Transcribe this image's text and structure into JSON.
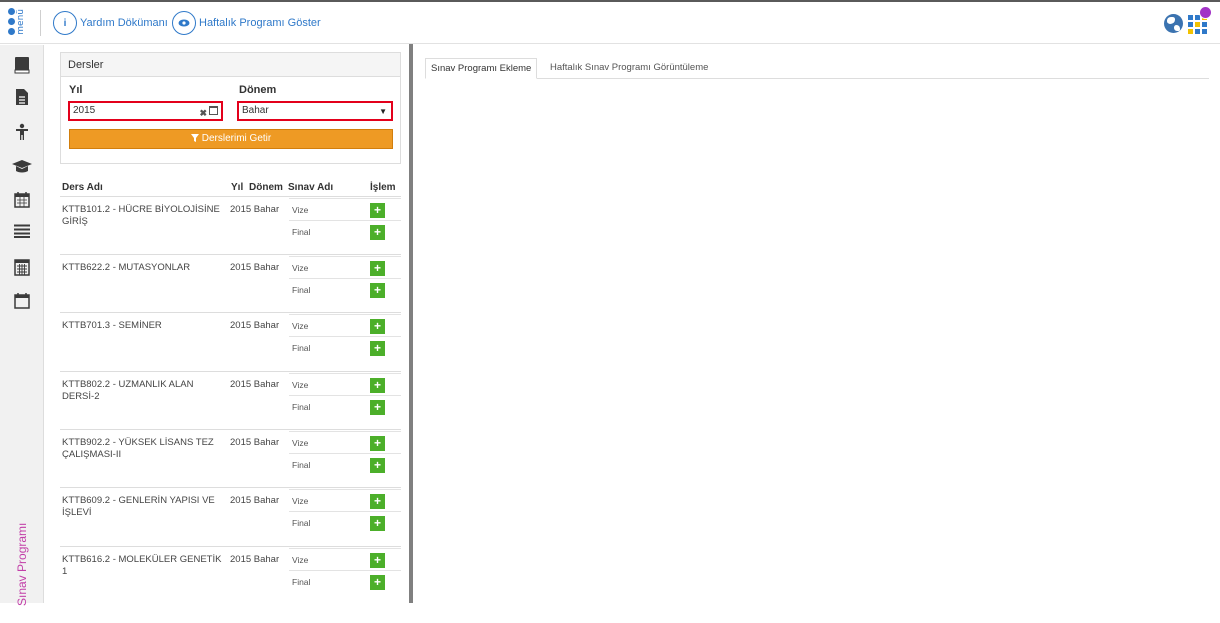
{
  "topbar": {
    "menu_label": "menü",
    "help_icon_glyph": "i",
    "help_label": "Yardım Dökümanı",
    "weekly_label": "Haftalık Programı Göster",
    "accent": "#2f79c9",
    "notification_color": "#a233c6"
  },
  "sidebar": {
    "items": [
      {
        "icon": "book-icon"
      },
      {
        "icon": "document-icon"
      },
      {
        "icon": "person-icon"
      },
      {
        "icon": "graduation-cap-icon"
      },
      {
        "icon": "calendar-icon"
      },
      {
        "icon": "list-icon"
      },
      {
        "icon": "calculator-icon"
      },
      {
        "icon": "calendar-empty-icon"
      }
    ],
    "vertical_label": "Sınav Programı",
    "vertical_color": "#c23fa8"
  },
  "filter": {
    "title": "Dersler",
    "year_label": "Yıl",
    "year_value": "2015",
    "term_label": "Dönem",
    "term_value": "Bahar",
    "button_label": "Derslerimi Getir",
    "button_color": "#ee9a24"
  },
  "table": {
    "headers": {
      "name": "Ders Adı",
      "year": "Yıl",
      "term": "Dönem",
      "exam": "Sınav Adı",
      "action": "İşlem"
    },
    "rows": [
      {
        "name": "KTTB101.2 - HÜCRE BİYOLOJİSİNE GİRİŞ",
        "year_term": "2015 Bahar",
        "exams": [
          "Vize",
          "Final"
        ]
      },
      {
        "name": "KTTB622.2 - MUTASYONLAR",
        "year_term": "2015 Bahar",
        "exams": [
          "Vize",
          "Final"
        ]
      },
      {
        "name": "KTTB701.3 - SEMİNER",
        "year_term": "2015 Bahar",
        "exams": [
          "Vize",
          "Final"
        ]
      },
      {
        "name": "KTTB802.2 - UZMANLIK ALAN DERSİ-2",
        "year_term": "2015 Bahar",
        "exams": [
          "Vize",
          "Final"
        ]
      },
      {
        "name": "KTTB902.2 - YÜKSEK LİSANS TEZ ÇALIŞMASI-II",
        "year_term": "2015 Bahar",
        "exams": [
          "Vize",
          "Final"
        ]
      },
      {
        "name": "KTTB609.2 - GENLERİN YAPISI VE İŞLEVİ",
        "year_term": "2015 Bahar",
        "exams": [
          "Vize",
          "Final"
        ]
      },
      {
        "name": "KTTB616.2 - MOLEKÜLER GENETİK 1",
        "year_term": "2015 Bahar",
        "exams": [
          "Vize",
          "Final"
        ]
      }
    ],
    "add_glyph": "+",
    "add_color": "#4caf2a"
  },
  "tabs": [
    {
      "label": "Sınav Programı Ekleme",
      "active": true
    },
    {
      "label": "Haftalık Sınav Programı Görüntüleme",
      "active": false
    }
  ]
}
